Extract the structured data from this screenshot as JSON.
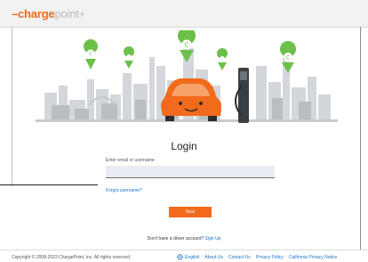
{
  "brand": {
    "logo_prefix": "–",
    "logo_charge": "charge",
    "logo_point": "poin",
    "logo_plus": "t+",
    "accent_color": "#f26a1b"
  },
  "login": {
    "title": "Login",
    "email_label": "Enter email or username",
    "email_value": "",
    "forgot_link": "Forgot username?",
    "next_button": "Next",
    "no_account_text": "Don't have a driver account?",
    "signup_link": "Sign Up"
  },
  "footer": {
    "copyright": "Copyright © 2008-2023 ChargePoint, Inc. All rights reserved.",
    "language": "English",
    "links": [
      "About Us",
      "Contact Us",
      "Privacy Policy",
      "California Privacy Notice"
    ]
  },
  "icons": [
    "globe-icon",
    "charger-pin-icon",
    "car-icon",
    "charging-station-icon"
  ]
}
